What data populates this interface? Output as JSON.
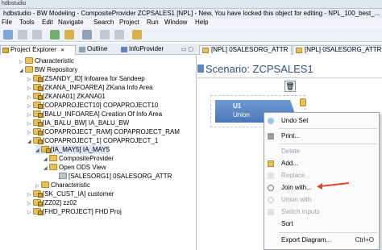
{
  "window": {
    "top_label": "hdbstudio",
    "title": "hdbstudio - BW Modeling - CompositeProvider ZCPSALES1 [NPL] - New, You have locked this object for editing - NPL_100_best_..."
  },
  "menu": [
    "File",
    "Tools",
    "Edit",
    "Navigate",
    "Search",
    "Project",
    "Run",
    "Window",
    "Help"
  ],
  "left_tabs": [
    {
      "label": "Project Explorer",
      "close": "✕"
    },
    {
      "label": "Outline"
    },
    {
      "label": "InfoProvider"
    }
  ],
  "tree": [
    {
      "text": "Characteristic",
      "indent": 0,
      "twisty": ""
    },
    {
      "text": "BW Repository",
      "indent": 0,
      "twisty": "◢"
    },
    {
      "text": "[ZSANDY_ID] Infoarea for Sandeep",
      "indent": 1,
      "twisty": "▷"
    },
    {
      "text": "[ZKANA_INFOAREA] ZKana Info Area",
      "indent": 1,
      "twisty": "▷"
    },
    {
      "text": "[ZKANA01] ZKANA01",
      "indent": 1,
      "twisty": "▷"
    },
    {
      "text": "[COPAPROJECT10] COPAPROJECT10",
      "indent": 1,
      "twisty": "▷"
    },
    {
      "text": "[BALU_INFOAREA] Creation Of Info Area",
      "indent": 1,
      "twisty": "▷"
    },
    {
      "text": "[IA_BALU_BW] IA_BALU_BW",
      "indent": 1,
      "twisty": "▷"
    },
    {
      "text": "[COPAPROJECT_RAM] COPAPROJECT_RAM",
      "indent": 1,
      "twisty": "▷"
    },
    {
      "text": "[COPAPROJECT_1] COPAPROJECT_1",
      "indent": 1,
      "twisty": "◢"
    },
    {
      "text": "[IA_MAY5] IA_MAY5",
      "indent": 2,
      "twisty": "◢"
    },
    {
      "text": "CompositeProvider",
      "indent": 3,
      "twisty": "◢"
    },
    {
      "text": "Open ODS View",
      "indent": 3,
      "twisty": "◢"
    },
    {
      "text": "[SALESORG1] 0SALESORG_ATTR",
      "indent": 4,
      "twisty": ""
    },
    {
      "text": "Characteristic",
      "indent": 2,
      "twisty": "▷"
    },
    {
      "text": "[SK_CUST_IA] customer",
      "indent": 1,
      "twisty": "▷"
    },
    {
      "text": "[ZZ02] zz02",
      "indent": 1,
      "twisty": "▷"
    },
    {
      "text": "[FHD_PROJECT] FHD Proj",
      "indent": 1,
      "twisty": "▷"
    }
  ],
  "editor_tabs": [
    "[NPL] 0SALESORG_ATTR",
    "[NPL] 0SALESORG_ATTR"
  ],
  "scenario_title": "Scenario: ZCPSALES1",
  "node": {
    "name": "U1",
    "type": "Union"
  },
  "context_menu": [
    {
      "label": "Undo Set",
      "disabled": false,
      "icon": "undo-icon"
    },
    {
      "label": "Print...",
      "disabled": false,
      "icon": "print-icon"
    },
    {
      "label": "Delete",
      "disabled": true,
      "icon": ""
    },
    {
      "label": "Add...",
      "disabled": false,
      "icon": "add-icon"
    },
    {
      "label": "Replace...",
      "disabled": true,
      "icon": "replace-icon"
    },
    {
      "label": "Join with...",
      "disabled": false,
      "icon": "join-icon"
    },
    {
      "label": "Union with",
      "disabled": true,
      "icon": "union-icon"
    },
    {
      "label": "Switch Inputs",
      "disabled": true,
      "icon": "switch-icon"
    },
    {
      "label": "Sort",
      "disabled": false,
      "icon": ""
    },
    {
      "label": "Export Diagram...",
      "disabled": false,
      "icon": "",
      "accel": "Ctrl+O"
    }
  ],
  "colors": {
    "highlight_arrow": "#e0492b",
    "scenario_text": "#2f4e86",
    "node_fill": "#4a78b8"
  }
}
